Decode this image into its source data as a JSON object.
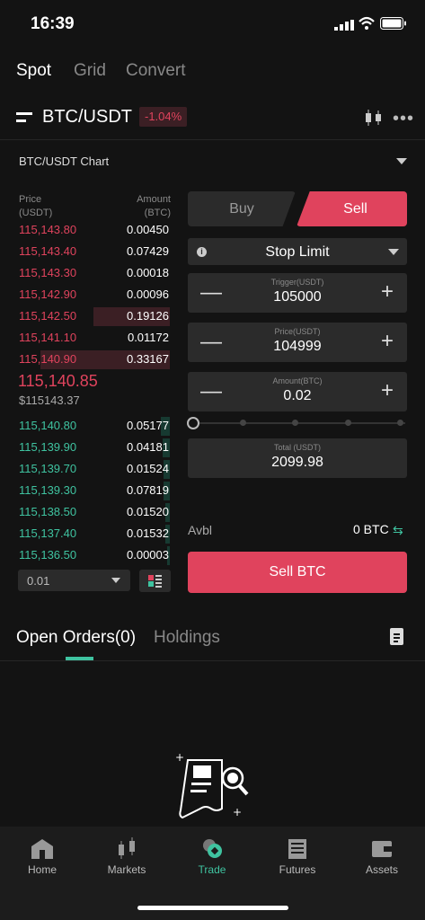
{
  "status_bar": {
    "time": "16:39"
  },
  "top_tabs": [
    {
      "label": "Spot",
      "active": true
    },
    {
      "label": "Grid",
      "active": false
    },
    {
      "label": "Convert",
      "active": false
    }
  ],
  "pair": {
    "name": "BTC/USDT",
    "change": "-1.04%"
  },
  "chart_label": "BTC/USDT Chart",
  "orderbook": {
    "price_header": [
      "Price",
      "(USDT)"
    ],
    "amount_header": [
      "Amount",
      "(BTC)"
    ],
    "asks": [
      {
        "price": "115,143.80",
        "amount": "0.00450",
        "depth": 0.0
      },
      {
        "price": "115,143.40",
        "amount": "0.07429",
        "depth": 0.0
      },
      {
        "price": "115,143.30",
        "amount": "0.00018",
        "depth": 0.0
      },
      {
        "price": "115,142.90",
        "amount": "0.00096",
        "depth": 0.0
      },
      {
        "price": "115,142.50",
        "amount": "0.19126",
        "depth": 0.5
      },
      {
        "price": "115,141.10",
        "amount": "0.01172",
        "depth": 0.0
      },
      {
        "price": "115,140.90",
        "amount": "0.33167",
        "depth": 0.85
      }
    ],
    "last_price": "115,140.85",
    "last_price_usd": "$115143.37",
    "bids": [
      {
        "price": "115,140.80",
        "amount": "0.05177",
        "depth": 0.06
      },
      {
        "price": "115,139.90",
        "amount": "0.04181",
        "depth": 0.05
      },
      {
        "price": "115,139.70",
        "amount": "0.01524",
        "depth": 0.04
      },
      {
        "price": "115,139.30",
        "amount": "0.07819",
        "depth": 0.04
      },
      {
        "price": "115,138.50",
        "amount": "0.01520",
        "depth": 0.03
      },
      {
        "price": "115,137.40",
        "amount": "0.01532",
        "depth": 0.03
      },
      {
        "price": "115,136.50",
        "amount": "0.00003",
        "depth": 0.02
      }
    ],
    "depth_select": "0.01"
  },
  "form": {
    "buy_label": "Buy",
    "sell_label": "Sell",
    "order_type": "Stop Limit",
    "trigger": {
      "label": "Trigger(USDT)",
      "value": "105000"
    },
    "price": {
      "label": "Price(USDT)",
      "value": "104999"
    },
    "amount": {
      "label": "Amount(BTC)",
      "value": "0.02"
    },
    "total": {
      "label": "Total (USDT)",
      "value": "2099.98"
    },
    "avbl_label": "Avbl",
    "avbl_value": "0 BTC",
    "submit_label": "Sell BTC",
    "slider_percent": 0
  },
  "orders_tabs": [
    {
      "label": "Open Orders(0)",
      "active": true
    },
    {
      "label": "Holdings",
      "active": false
    }
  ],
  "bottom_nav": [
    {
      "label": "Home",
      "icon": "home-icon",
      "active": false
    },
    {
      "label": "Markets",
      "icon": "markets-icon",
      "active": false
    },
    {
      "label": "Trade",
      "icon": "trade-icon",
      "active": true
    },
    {
      "label": "Futures",
      "icon": "futures-icon",
      "active": false
    },
    {
      "label": "Assets",
      "icon": "assets-icon",
      "active": false
    }
  ],
  "colors": {
    "sell": "#e0435d",
    "buy": "#3fc3a0",
    "background": "#131313",
    "panel": "#2b2b2b"
  }
}
